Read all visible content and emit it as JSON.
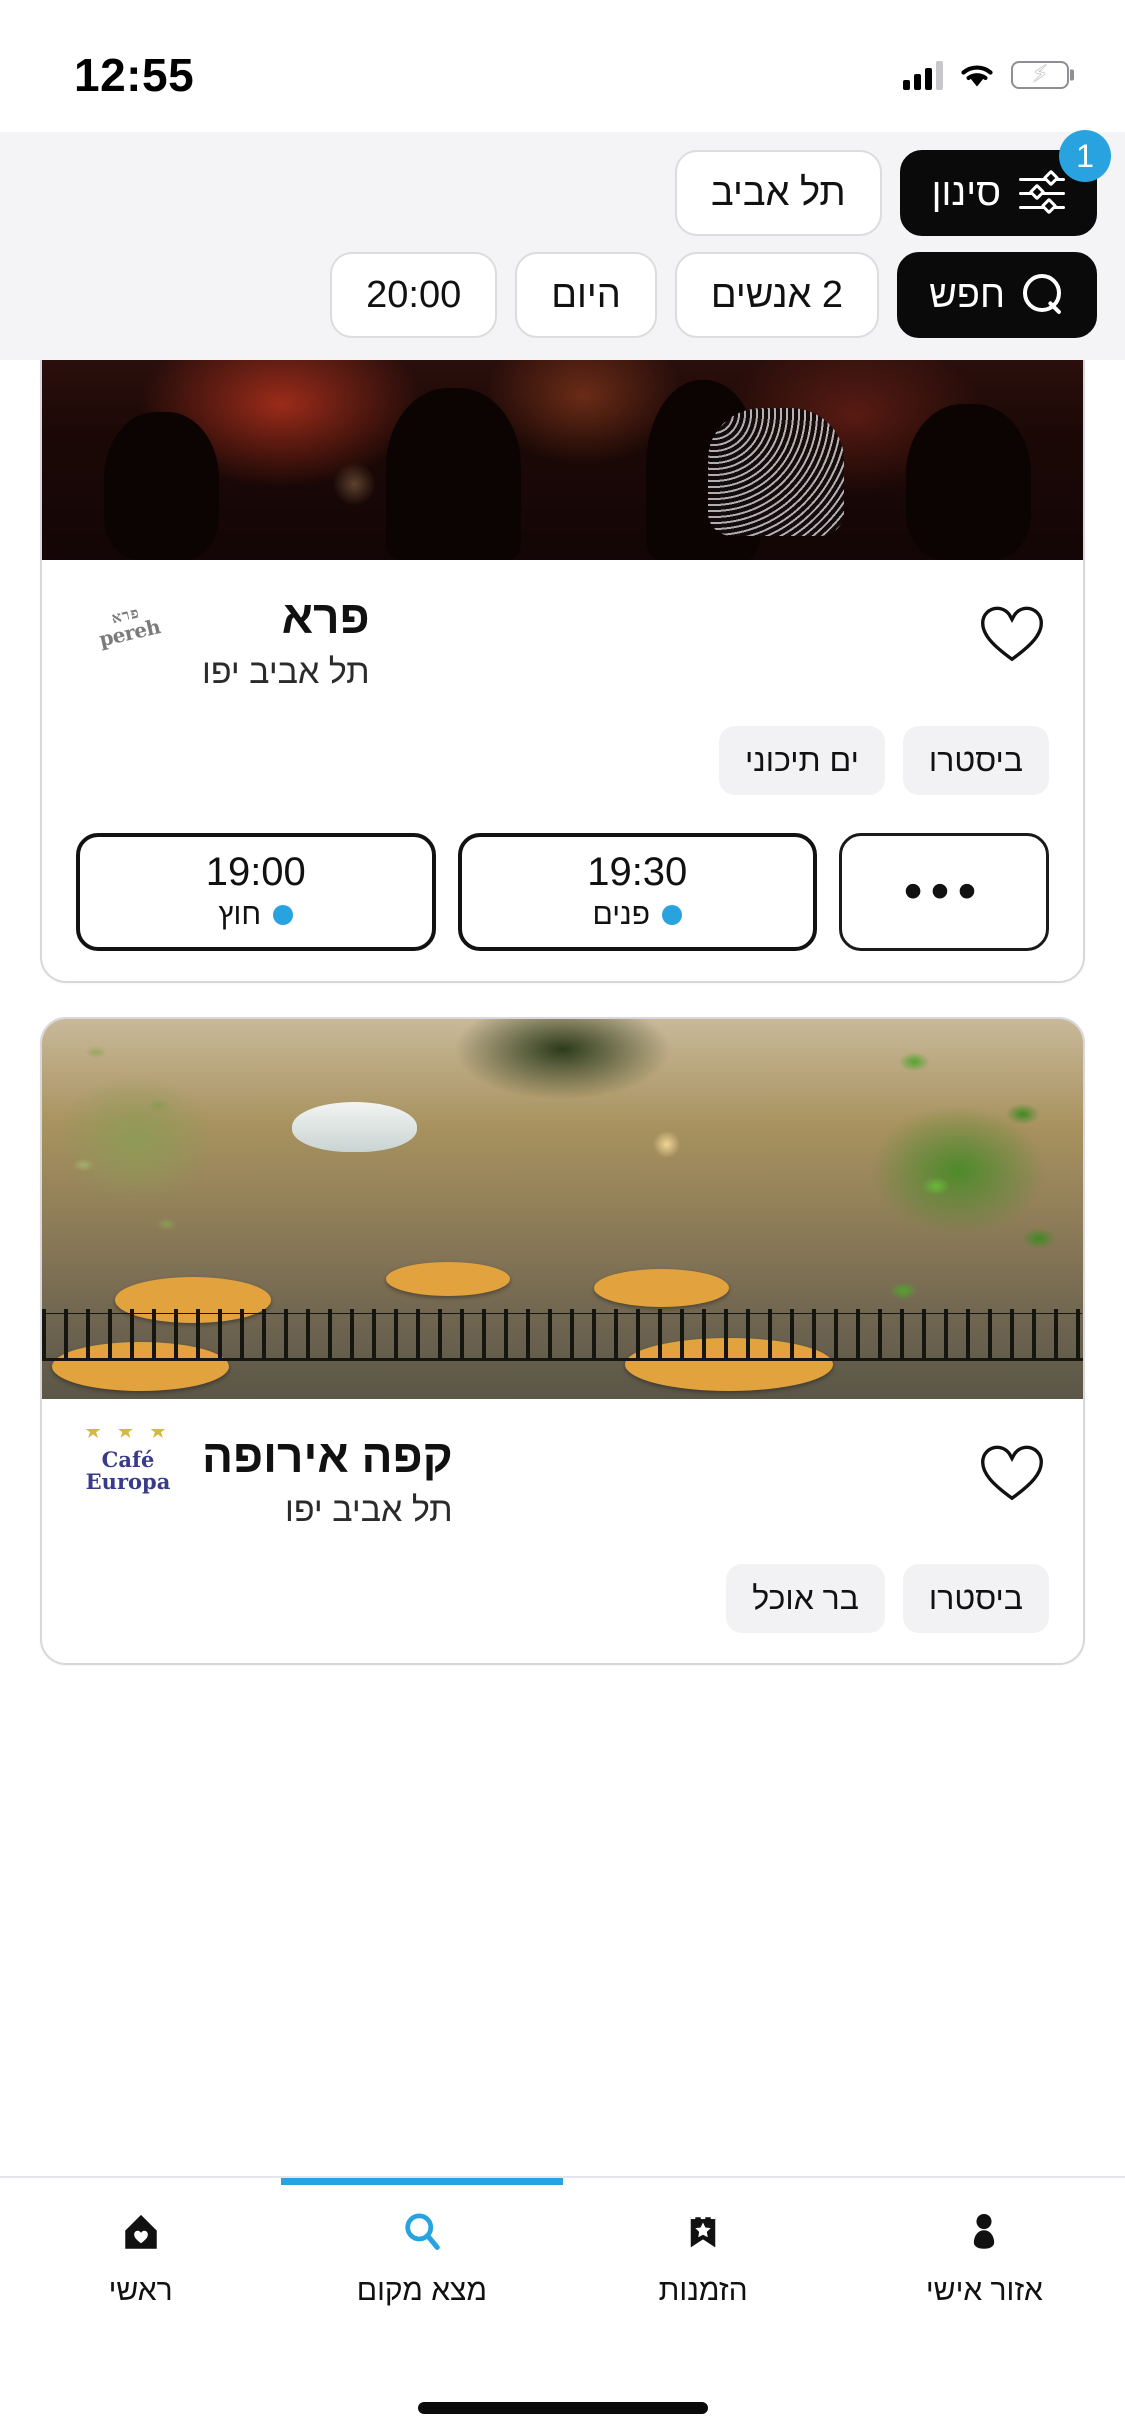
{
  "status_bar": {
    "time": "12:55",
    "cellular_icon": "signal-bars-icon",
    "wifi_icon": "wifi-icon",
    "battery_icon": "battery-charging-icon"
  },
  "filter_header": {
    "filter_button": {
      "label": "סינון",
      "icon": "sliders-icon",
      "badge_count": "1"
    },
    "city_chip": {
      "label": "תל אביב"
    },
    "search_button": {
      "label": "חפש",
      "icon": "search-icon"
    },
    "party_size_chip": {
      "label": "2 אנשים"
    },
    "date_chip": {
      "label": "היום"
    },
    "time_chip": {
      "label": "20:00"
    }
  },
  "results": [
    {
      "name": "פרא",
      "city": "תל אביב יפו",
      "logo_text": "pereh",
      "logo_sub": "פרא",
      "logo_name": "pereh-logo",
      "favorite_icon": "heart-outline-icon",
      "photo_name": "restaurant-interior-photo",
      "tags": [
        "ביסטרו",
        "ים תיכוני"
      ],
      "slots": [
        {
          "time": "19:00",
          "seating": "חוץ",
          "dot_color": "#29a3e0"
        },
        {
          "time": "19:30",
          "seating": "פנים",
          "dot_color": "#29a3e0"
        }
      ],
      "more_slots_label": "•••"
    },
    {
      "name": "קפה אירופה",
      "city": "תל אביב יפו",
      "logo_text": "Café Europa",
      "logo_sub": "★ ★ ★",
      "logo_name": "cafe-europa-logo",
      "favorite_icon": "heart-outline-icon",
      "photo_name": "restaurant-patio-photo",
      "tags": [
        "ביסטרו",
        "בר אוכל"
      ],
      "slots": [],
      "more_slots_label": ""
    }
  ],
  "tab_bar": {
    "active_index": 1,
    "accent_color": "#29a3e0",
    "items": [
      {
        "label": "ראשי",
        "icon": "home-heart-icon"
      },
      {
        "label": "מצא מקום",
        "icon": "search-icon"
      },
      {
        "label": "הזמנות",
        "icon": "bookmark-star-icon"
      },
      {
        "label": "אזור אישי",
        "icon": "person-icon"
      }
    ]
  },
  "home_indicator": "home-indicator-bar"
}
